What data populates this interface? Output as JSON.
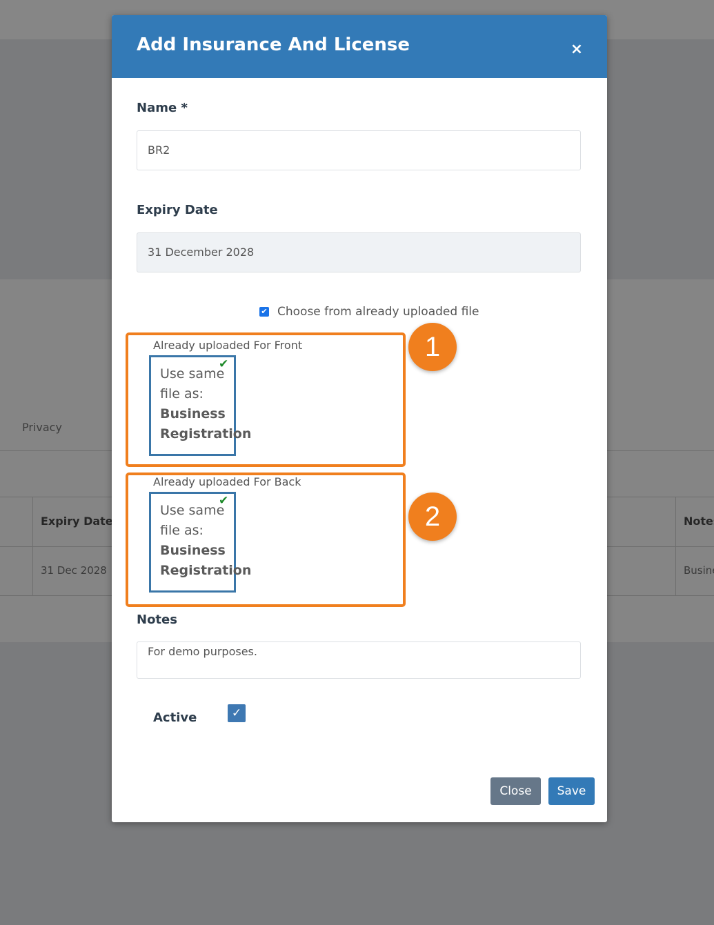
{
  "background": {
    "privacy_label": "Privacy",
    "table": {
      "headers": [
        "Expiry Date",
        "Notes"
      ],
      "row": [
        "31 Dec 2028",
        "Busine"
      ]
    }
  },
  "modal": {
    "title": "Add Insurance And License",
    "close_icon": "×",
    "name": {
      "label": "Name *",
      "value": "BR2"
    },
    "expiry": {
      "label": "Expiry Date",
      "value": "31 December 2028"
    },
    "choose_existing": {
      "label": "Choose from already uploaded file",
      "checked": true
    },
    "uploads": [
      {
        "caption": "Already uploaded For Front",
        "line1": "Use same",
        "line2": "file as:",
        "line3": "Business",
        "line4": "Registration",
        "badge": "1"
      },
      {
        "caption": "Already uploaded For Back",
        "line1": "Use same",
        "line2": "file as:",
        "line3": "Business",
        "line4": "Registration",
        "badge": "2"
      }
    ],
    "notes": {
      "label": "Notes",
      "value": "For demo  purposes."
    },
    "active": {
      "label": "Active",
      "checked": true
    },
    "buttons": {
      "close": "Close",
      "save": "Save"
    },
    "colors": {
      "header": "#337ab7",
      "highlight": "#f07f1e",
      "close_button": "#667789"
    }
  }
}
